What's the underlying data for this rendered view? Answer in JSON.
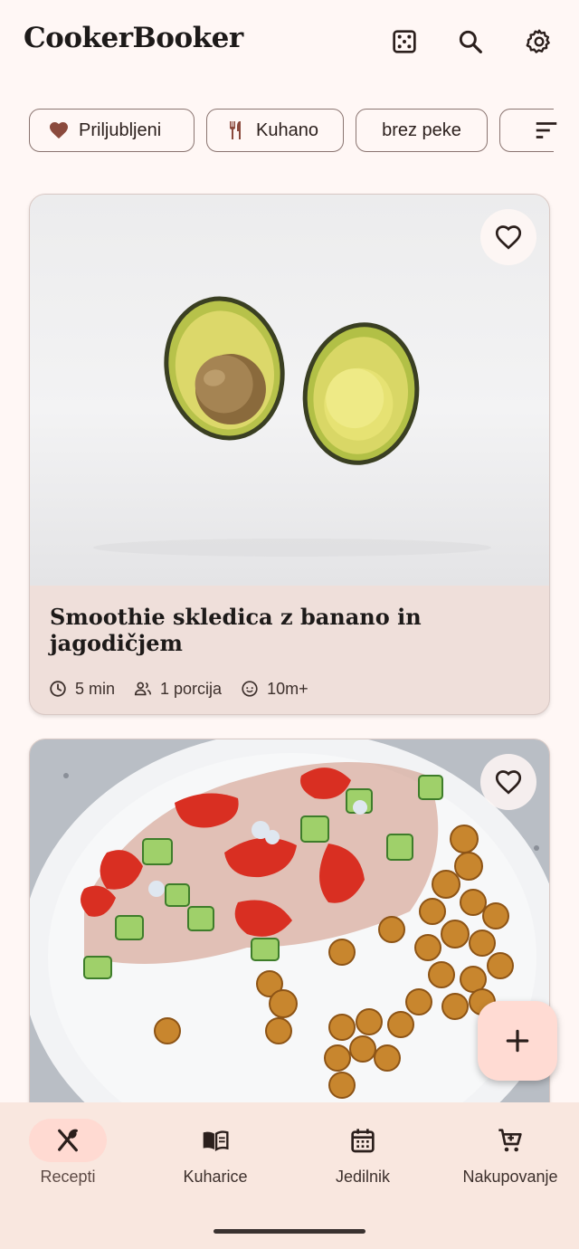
{
  "app": {
    "title": "CookerBooker"
  },
  "top_actions": [
    {
      "icon": "dice-icon"
    },
    {
      "icon": "search-icon"
    },
    {
      "icon": "gear-icon"
    }
  ],
  "filters": {
    "chips": [
      {
        "label": "Priljubljeni",
        "icon": "heart-icon"
      },
      {
        "label": "Kuhano",
        "icon": "utensils-icon"
      },
      {
        "label": "brez peke"
      }
    ],
    "sort_icon": "sort-icon"
  },
  "recipes": [
    {
      "title": "Smoothie skledica z banano in jagodičjem",
      "time": "5 min",
      "servings": "1 porcija",
      "age": "10m+",
      "favorite": false,
      "image": "avocado halves on white background"
    },
    {
      "title": "",
      "favorite": false,
      "image": "cucumber tomato salad with roasted chickpeas on a plate"
    }
  ],
  "fab": {
    "icon": "plus-icon"
  },
  "bottom_nav": {
    "items": [
      {
        "label": "Recepti",
        "icon": "fork-spoon-icon",
        "active": true
      },
      {
        "label": "Kuharice",
        "icon": "book-icon",
        "active": false
      },
      {
        "label": "Jedilnik",
        "icon": "calendar-icon",
        "active": false
      },
      {
        "label": "Nakupovanje",
        "icon": "cart-icon",
        "active": false
      }
    ]
  },
  "colors": {
    "background": "#fff7f5",
    "accent": "#8b4a3d",
    "card": "#efdfda",
    "nav": "#f9e7df",
    "active_pill": "#ffdad2"
  }
}
